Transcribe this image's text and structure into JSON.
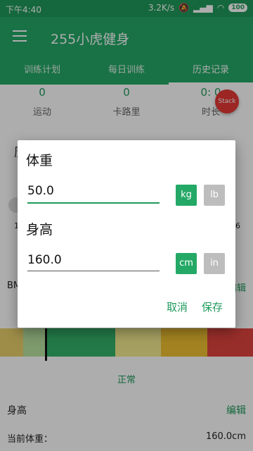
{
  "status_bar": {
    "time": "下午4:40",
    "speed": "3.2K/s",
    "battery": "100"
  },
  "app": {
    "title": "255小虎健身"
  },
  "tabs": [
    "训练计划",
    "每日训练",
    "历史记录"
  ],
  "stats": [
    {
      "value": "0",
      "label": "运动"
    },
    {
      "value": "0",
      "label": "卡路里"
    },
    {
      "value": "0: 0",
      "label": "时长"
    }
  ],
  "stack_button": "Stack",
  "background": {
    "card_header": "历",
    "left_value": "1",
    "right_value": "6",
    "bmi_label": "BMI",
    "edit": "编辑",
    "scale_status": "正常",
    "height_label": "身高",
    "current_weight_label": "当前体重：",
    "current_value": "160.0cm"
  },
  "scale_colors": [
    "#e9d06b",
    "#b9e3a0",
    "#34b36a",
    "#34b36a",
    "#34b36a",
    "#f4ec8f",
    "#f4ec8f",
    "#f1c232",
    "#f1c232",
    "#e0443e",
    "#e0443e"
  ],
  "dialog": {
    "weight_title": "体重",
    "weight_value": "50.0",
    "weight_unit_on": "kg",
    "weight_unit_off": "lb",
    "height_title": "身高",
    "height_value": "160.0",
    "height_unit_on": "cm",
    "height_unit_off": "in",
    "cancel": "取消",
    "save": "保存"
  }
}
